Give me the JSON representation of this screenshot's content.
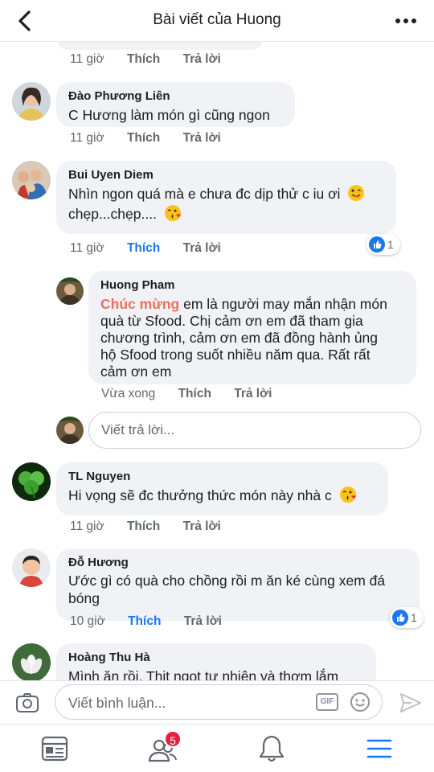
{
  "header": {
    "title": "Bài viết của Huong"
  },
  "top_comment": {
    "time": "11 giờ",
    "like": "Thích",
    "reply": "Trả lời"
  },
  "comments": [
    {
      "name": "Đào Phương Liên",
      "text": "C Hương làm món gì cũng ngon",
      "time": "11 giờ",
      "like": "Thích",
      "reply": "Trả lời"
    },
    {
      "name": "Bui Uyen Diem",
      "text_line1": "Nhìn ngon quá mà e chưa đc dịp thử c iu ơi",
      "text_line2": "chẹp...chẹp....",
      "time": "11 giờ",
      "like": "Thích",
      "reply": "Trả lời",
      "reactions": "1"
    },
    {
      "name": "TL Nguyen",
      "text": "Hi vọng sẽ đc thưởng thức món này nhà c",
      "time": "11 giờ",
      "like": "Thích",
      "reply": "Trả lời"
    },
    {
      "name": "Đỗ Hương",
      "text_line1": "Ước gì có quà cho chồng rồi m ăn ké cùng xem đá",
      "text_line2": "bóng",
      "time": "10 giờ",
      "like": "Thích",
      "reply": "Trả lời",
      "reactions": "1"
    },
    {
      "name": "Hoàng Thu Hà",
      "text": "Mình ăn rồi. Thịt ngọt tự nhiên và thơm lắm"
    }
  ],
  "reply": {
    "name": "Huong Pham",
    "highlight": "Chúc mừng",
    "text_line1": "em là người may mắn nhận món",
    "text_line2": "quà từ Sfood. Chị cảm ơn em đã tham gia",
    "text_line3": "chương trình, cảm ơn em đã đồng hành ủng",
    "text_line4": "hộ Sfood trong suốt nhiều năm qua. Rất rất",
    "text_line5": "cảm ơn em",
    "time": "Vừa xong",
    "like": "Thích",
    "reply": "Trả lời"
  },
  "reply_input": {
    "placeholder": "Viết trả lời..."
  },
  "composer": {
    "placeholder": "Viết bình luận...",
    "gif": "GIF"
  },
  "nav": {
    "friends_badge": "5"
  },
  "colors": {
    "accent": "#1877f2",
    "highlight": "#e8705e",
    "bubble": "#f0f2f5",
    "badge": "#e41e3f"
  }
}
